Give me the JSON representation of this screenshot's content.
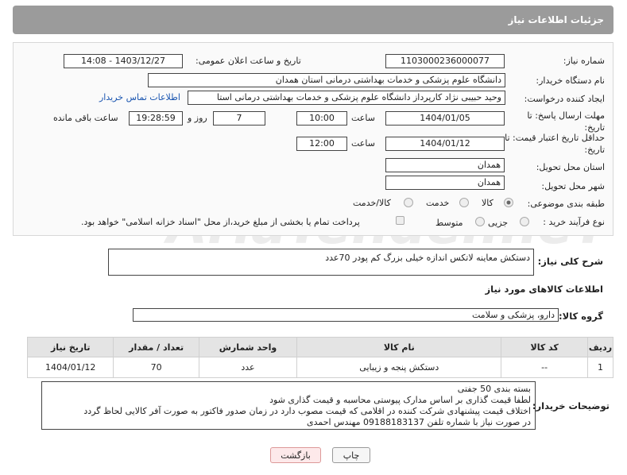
{
  "header": {
    "title": "جزئیات اطلاعات نیاز"
  },
  "fields": {
    "need_number_label": "شماره نیاز:",
    "need_number": "1103000236000077",
    "announce_label": "تاریخ و ساعت اعلان عمومی:",
    "announce_value": "1403/12/27 - 14:08",
    "buyer_org_label": "نام دستگاه خریدار:",
    "buyer_org": "دانشگاه علوم پزشکی و خدمات بهداشتی درمانی استان همدان",
    "creator_label": "ایجاد کننده درخواست:",
    "creator": "وحید حبیبی نژاد کارپرداز دانشگاه علوم پزشکی و خدمات بهداشتی درمانی استا",
    "contact_link": "اطلاعات تماس خریدار",
    "send_deadline_label_1": "مهلت ارسال پاسخ: تا",
    "send_deadline_label_2": "تاریخ:",
    "send_date": "1404/01/05",
    "time_label": "ساعت",
    "send_time": "10:00",
    "days_value": "7",
    "days_label": "روز و",
    "remaining_time": "19:28:59",
    "remaining_label": "ساعت باقی مانده",
    "price_validity_label_1": "حداقل تاریخ اعتبار قیمت: تا",
    "price_validity_label_2": "تاریخ:",
    "price_date": "1404/01/12",
    "price_time_label": "ساعت",
    "price_time": "12:00",
    "province_label": "استان محل تحویل:",
    "province": "همدان",
    "city_label": "شهر محل تحویل:",
    "city": "همدان",
    "category_label": "طبقه بندی موضوعی:",
    "category_options": [
      "کالا",
      "خدمت",
      "کالا/خدمت"
    ],
    "process_label": "نوع فرآیند خرید :",
    "process_options": [
      "جزیی",
      "متوسط"
    ],
    "payment_note": "پرداخت تمام یا بخشی از مبلغ خرید،از محل \"اسناد خزانه اسلامی\" خواهد بود."
  },
  "description": {
    "label": "شرح کلی نیاز:",
    "text": "دستکش معاینه لاتکس اندازه خیلی بزرگ کم پودر 70عدد"
  },
  "goods_info": {
    "title": "اطلاعات کالاهای مورد نیاز"
  },
  "goods_group": {
    "label": "گروه کالا:",
    "value": "دارو، پزشکی و سلامت"
  },
  "table": {
    "headers": [
      "ردیف",
      "کد کالا",
      "نام کالا",
      "واحد شمارش",
      "تعداد / مقدار",
      "تاریخ نیاز"
    ],
    "rows": [
      [
        "1",
        "--",
        "دستکش پنجه و زیبایی",
        "عدد",
        "70",
        "1404/01/12"
      ]
    ]
  },
  "buyer_notes": {
    "label": "توضیحات خریدار:",
    "lines": [
      "بسته بندی 50 جفتی",
      "لطفا قیمت گذاری بر اساس مدارک پیوستی محاسبه و قیمت گذاری شود",
      "اختلاف قیمت پیشنهادی شرکت کننده در اقلامی که قیمت مصوب دارد در زمان صدور فاکتور به صورت آفر کالایی لحاظ گردد",
      "در صورت نیاز با شماره تلفن 09188183137 مهندس احمدی"
    ]
  },
  "buttons": {
    "print": "چاپ",
    "back": "بازگشت"
  },
  "watermark": "AriaTender.neT"
}
